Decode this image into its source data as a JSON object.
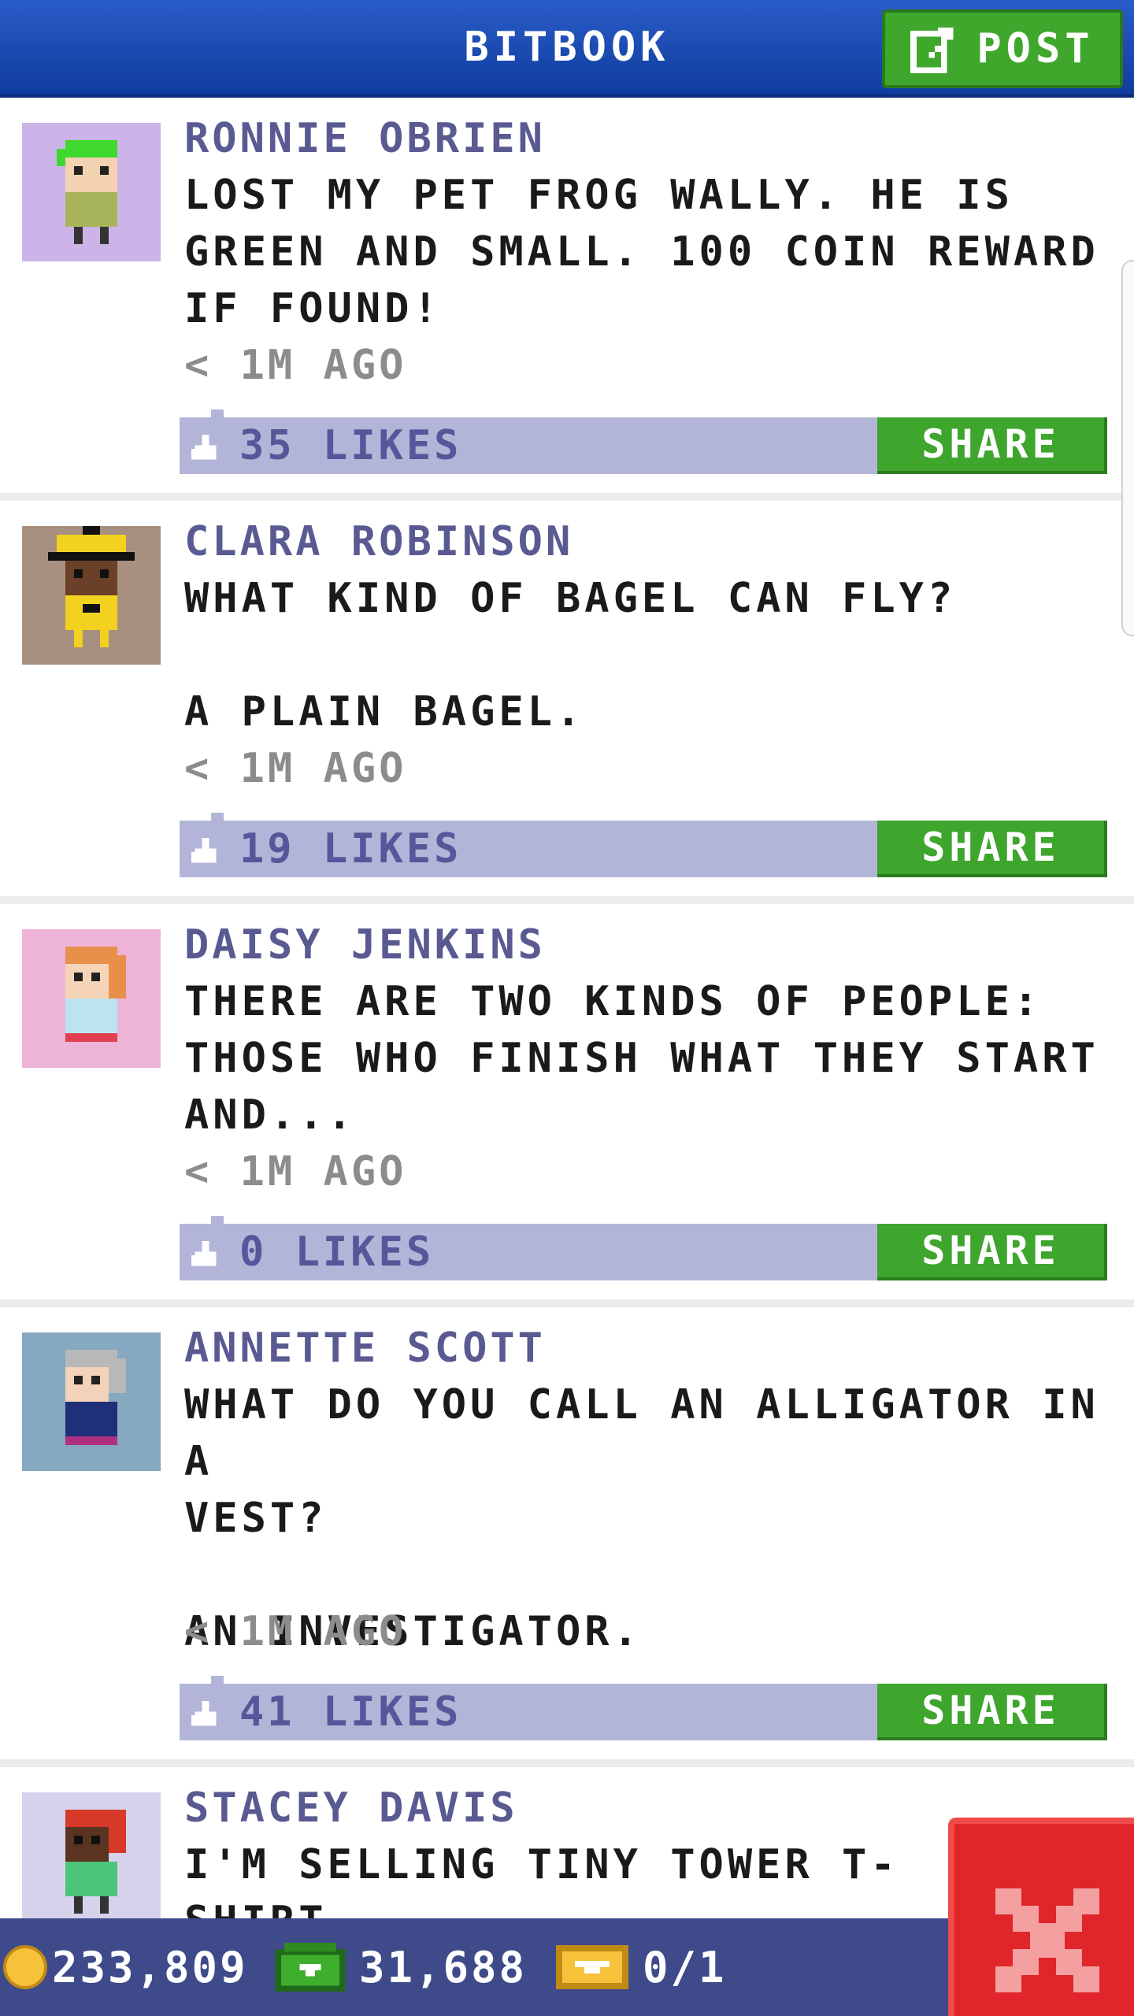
{
  "header": {
    "title": "BITBOOK",
    "post_label": "POST"
  },
  "posts": [
    {
      "author": "RONNIE OBRIEN",
      "message": "LOST MY PET FROG WALLY. HE IS\nGREEN AND SMALL. 100 COIN REWARD\nIF FOUND!",
      "time": "< 1M AGO",
      "likes": "35 LIKES",
      "share_label": "SHARE",
      "avatar_bg": "#cdb4e8"
    },
    {
      "author": "CLARA ROBINSON",
      "message": "WHAT KIND OF BAGEL CAN FLY?\n\nA PLAIN BAGEL.",
      "time": "< 1M AGO",
      "likes": "19 LIKES",
      "share_label": "SHARE",
      "avatar_bg": "#a89080"
    },
    {
      "author": "DAISY JENKINS",
      "message": "THERE ARE TWO KINDS OF PEOPLE:\nTHOSE WHO FINISH WHAT THEY START\nAND...",
      "time": "< 1M AGO",
      "likes": "0 LIKES",
      "share_label": "SHARE",
      "avatar_bg": "#eeb4d8"
    },
    {
      "author": "ANNETTE SCOTT",
      "message": "WHAT DO YOU CALL AN ALLIGATOR IN A\nVEST?\n\nAN INVESTIGATOR.",
      "time": "< 1M AGO",
      "likes": "41 LIKES",
      "share_label": "SHARE",
      "avatar_bg": "#86a8c0"
    },
    {
      "author": "STACEY DAVIS",
      "message": "I'M SELLING TINY TOWER T-SHIRT",
      "avatar_bg": "#d6d2ec"
    }
  ],
  "bottom_bar": {
    "coins": "233,809",
    "bux": "31,688",
    "tickets": "0/1"
  },
  "icons": {
    "post": "edit-icon",
    "like": "thumbs-up-icon",
    "coin": "coin-icon",
    "bux": "bux-icon",
    "ticket": "ticket-icon",
    "close": "close-icon"
  },
  "colors": {
    "header": "#1f4fb5",
    "accent_green": "#3ea52d",
    "likes_bar": "#b3b5d8",
    "author": "#5a5a92",
    "close": "#e0262a"
  }
}
